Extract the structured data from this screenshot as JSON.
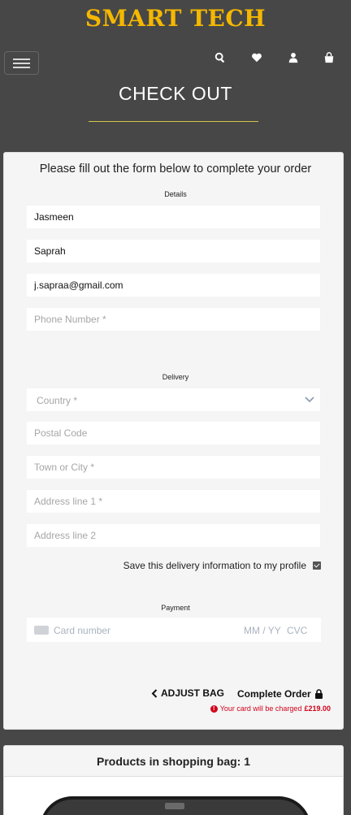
{
  "header": {
    "brand": "SMART TECH",
    "icons": [
      "search-icon",
      "heart-icon",
      "user-icon",
      "shopping-bag-icon"
    ],
    "page_title": "CHECK OUT",
    "brand_color": "#f5b800"
  },
  "form": {
    "heading": "Please fill out the form below to complete your order",
    "details_label": "Details",
    "first_name": "Jasmeen",
    "last_name": "Saprah",
    "email": "j.sapraa@gmail.com",
    "phone_placeholder": "Phone Number *",
    "delivery_label": "Delivery",
    "country_placeholder": "Country *",
    "postal_placeholder": "Postal Code",
    "town_placeholder": "Town or City *",
    "address1_placeholder": "Address line 1 *",
    "address2_placeholder": "Address line 2",
    "save_info_label": "Save this delivery information to my profile",
    "save_info_checked": true,
    "payment_label": "Payment",
    "card_number_placeholder": "Card number",
    "expiry_placeholder": "MM / YY",
    "cvc_placeholder": "CVC"
  },
  "actions": {
    "adjust_bag": "ADJUST BAG",
    "complete_order": "Complete Order",
    "charge_prefix": "Your card will be charged",
    "charge_amount": "£219.00",
    "warning_color": "#d0021b"
  },
  "bag": {
    "heading": "Products in shopping bag: 1"
  }
}
